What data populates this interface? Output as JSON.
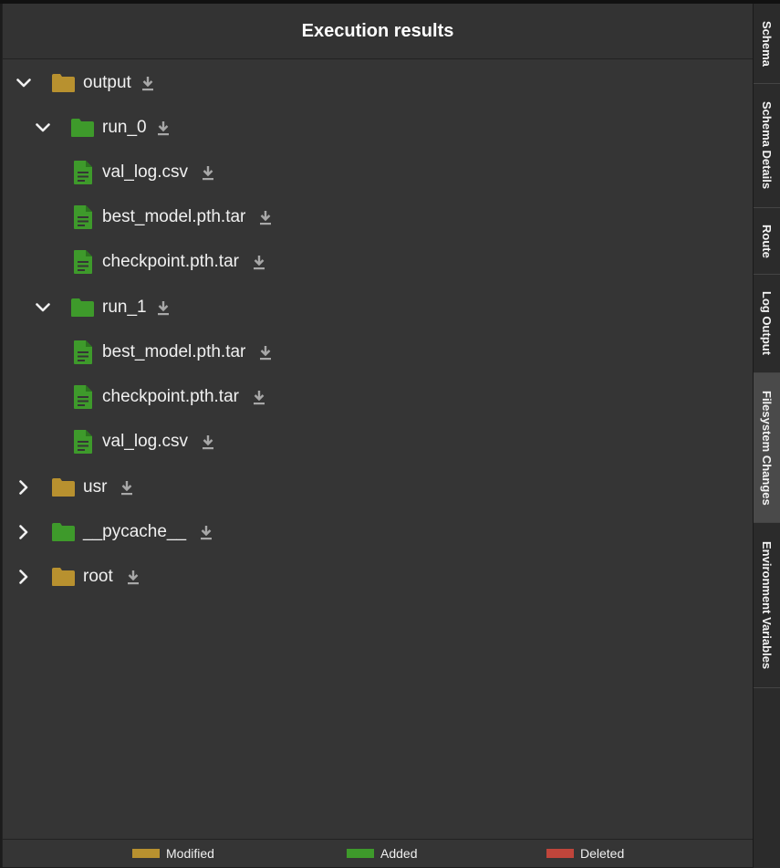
{
  "header": {
    "title": "Execution results"
  },
  "colors": {
    "modified": "#b8912f",
    "added": "#3e9a2b",
    "deleted": "#c0453b",
    "download": "#a8a8a8"
  },
  "tree": {
    "output": {
      "label": "output",
      "status": "modified",
      "expanded": true,
      "run_0": {
        "label": "run_0",
        "status": "added",
        "expanded": true,
        "files": [
          "val_log.csv",
          "best_model.pth.tar",
          "checkpoint.pth.tar"
        ]
      },
      "run_1": {
        "label": "run_1",
        "status": "added",
        "expanded": true,
        "files": [
          "best_model.pth.tar",
          "checkpoint.pth.tar",
          "val_log.csv"
        ]
      }
    },
    "usr": {
      "label": "usr",
      "status": "modified",
      "expanded": false
    },
    "pycache": {
      "label": "__pycache__",
      "status": "added",
      "expanded": false
    },
    "root": {
      "label": "root",
      "status": "modified",
      "expanded": false
    }
  },
  "legend": {
    "modified": "Modified",
    "added": "Added",
    "deleted": "Deleted"
  },
  "sidebar": {
    "tabs": [
      "Schema",
      "Schema Details",
      "Route",
      "Log Output",
      "Filesystem Changes",
      "Environment Variables"
    ],
    "active": "Filesystem Changes"
  }
}
